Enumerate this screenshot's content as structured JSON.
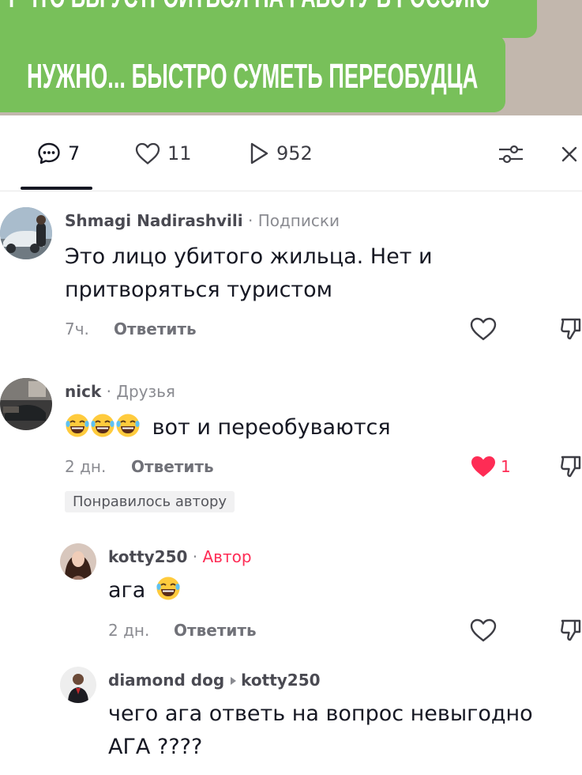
{
  "video": {
    "caption_line1": "Y ЧТО БЫ УСТРОИТЬСЯ НА РАБОТУ В РОССИЮ",
    "caption_line2": "НУЖНО... БЫСТРО СУМЕТЬ ПЕРЕОБУДЦА",
    "caption_bg": "#78c05a"
  },
  "stats": {
    "comments": "7",
    "likes": "11",
    "views": "952"
  },
  "comments": [
    {
      "username": "Shmagi Nadirashvili",
      "tag": "Подписки",
      "text_line1": "Это лицо убитого жильца. Нет и",
      "text_line2": "притворяться туристом",
      "time": "7ч.",
      "reply": "Ответить"
    },
    {
      "username": "nick",
      "tag": "Друзья",
      "text": "вот и переобуваются",
      "emoji": "laughing-tears-emoji x3",
      "time": "2 дн.",
      "reply": "Ответить",
      "like_count": "1",
      "liked_badge": "Понравилось автору"
    },
    {
      "username": "kotty250",
      "tag": "Автор",
      "text": "ага",
      "emoji": "laughing-tears-emoji",
      "time": "2 дн.",
      "reply": "Ответить"
    },
    {
      "username": "diamond dog",
      "reply_to": "kotty250",
      "text_line1": "чего ага ответь на вопрос невыгодно",
      "text_line2": "АГА ????"
    }
  ],
  "colors": {
    "accent": "#fe2c55",
    "text": "#161823",
    "muted": "#8a8b91"
  }
}
